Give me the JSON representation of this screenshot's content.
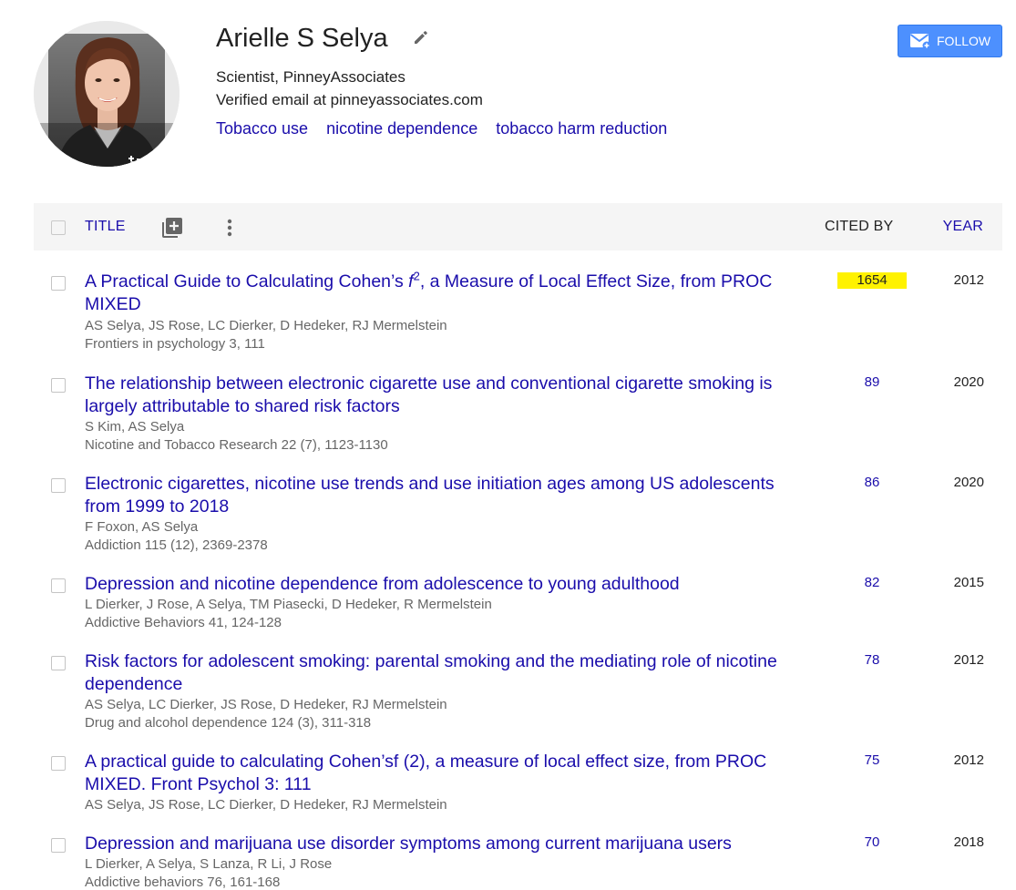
{
  "profile": {
    "name": "Arielle S Selya",
    "affiliation": "Scientist, PinneyAssociates",
    "email": "Verified email at pinneyassociates.com",
    "interests": [
      "Tobacco use",
      "nicotine dependence",
      "tobacco harm reduction"
    ],
    "follow_label": "FOLLOW"
  },
  "colors": {
    "link": "#1a0dab",
    "follow_bg": "#4d90fe",
    "highlight": "#fff200"
  },
  "table": {
    "header": {
      "title": "TITLE",
      "cited_by": "CITED BY",
      "year": "YEAR"
    },
    "rows": [
      {
        "title": "A Practical Guide to Calculating Cohen’s f², a Measure of Local Effect Size, from PROC MIXED",
        "title_main": "A Practical Guide to Calculating Cohen’s ",
        "title_f": "f",
        "title_sup": "2",
        "title_rest": ", a Measure of Local Effect Size, from PROC MIXED",
        "authors": "AS Selya, JS Rose, LC Dierker, D Hedeker, RJ Mermelstein",
        "venue": "Frontiers in psychology 3, 111",
        "cited": "1654",
        "year": "2012"
      },
      {
        "title": "The relationship between electronic cigarette use and conventional cigarette smoking is largely attributable to shared risk factors",
        "authors": "S Kim, AS Selya",
        "venue": "Nicotine and Tobacco Research 22 (7), 1123-1130",
        "cited": "89",
        "year": "2020"
      },
      {
        "title": "Electronic cigarettes, nicotine use trends and use initiation ages among US adolescents from 1999 to 2018",
        "authors": "F Foxon, AS Selya",
        "venue": "Addiction 115 (12), 2369-2378",
        "cited": "86",
        "year": "2020"
      },
      {
        "title": "Depression and nicotine dependence from adolescence to young adulthood",
        "authors": "L Dierker, J Rose, A Selya, TM Piasecki, D Hedeker, R Mermelstein",
        "venue": "Addictive Behaviors 41, 124-128",
        "cited": "82",
        "year": "2015"
      },
      {
        "title": "Risk factors for adolescent smoking: parental smoking and the mediating role of nicotine dependence",
        "authors": "AS Selya, LC Dierker, JS Rose, D Hedeker, RJ Mermelstein",
        "venue": "Drug and alcohol dependence 124 (3), 311-318",
        "cited": "78",
        "year": "2012"
      },
      {
        "title": "A practical guide to calculating Cohen’sf (2), a measure of local effect size, from PROC MIXED. Front Psychol 3: 111",
        "authors": "AS Selya, JS Rose, LC Dierker, D Hedeker, RJ Mermelstein",
        "venue": "",
        "cited": "75",
        "year": "2012"
      },
      {
        "title": "Depression and marijuana use disorder symptoms among current marijuana users",
        "authors": "L Dierker, A Selya, S Lanza, R Li, J Rose",
        "venue": "Addictive behaviors 76, 161-168",
        "cited": "70",
        "year": "2018"
      }
    ]
  }
}
